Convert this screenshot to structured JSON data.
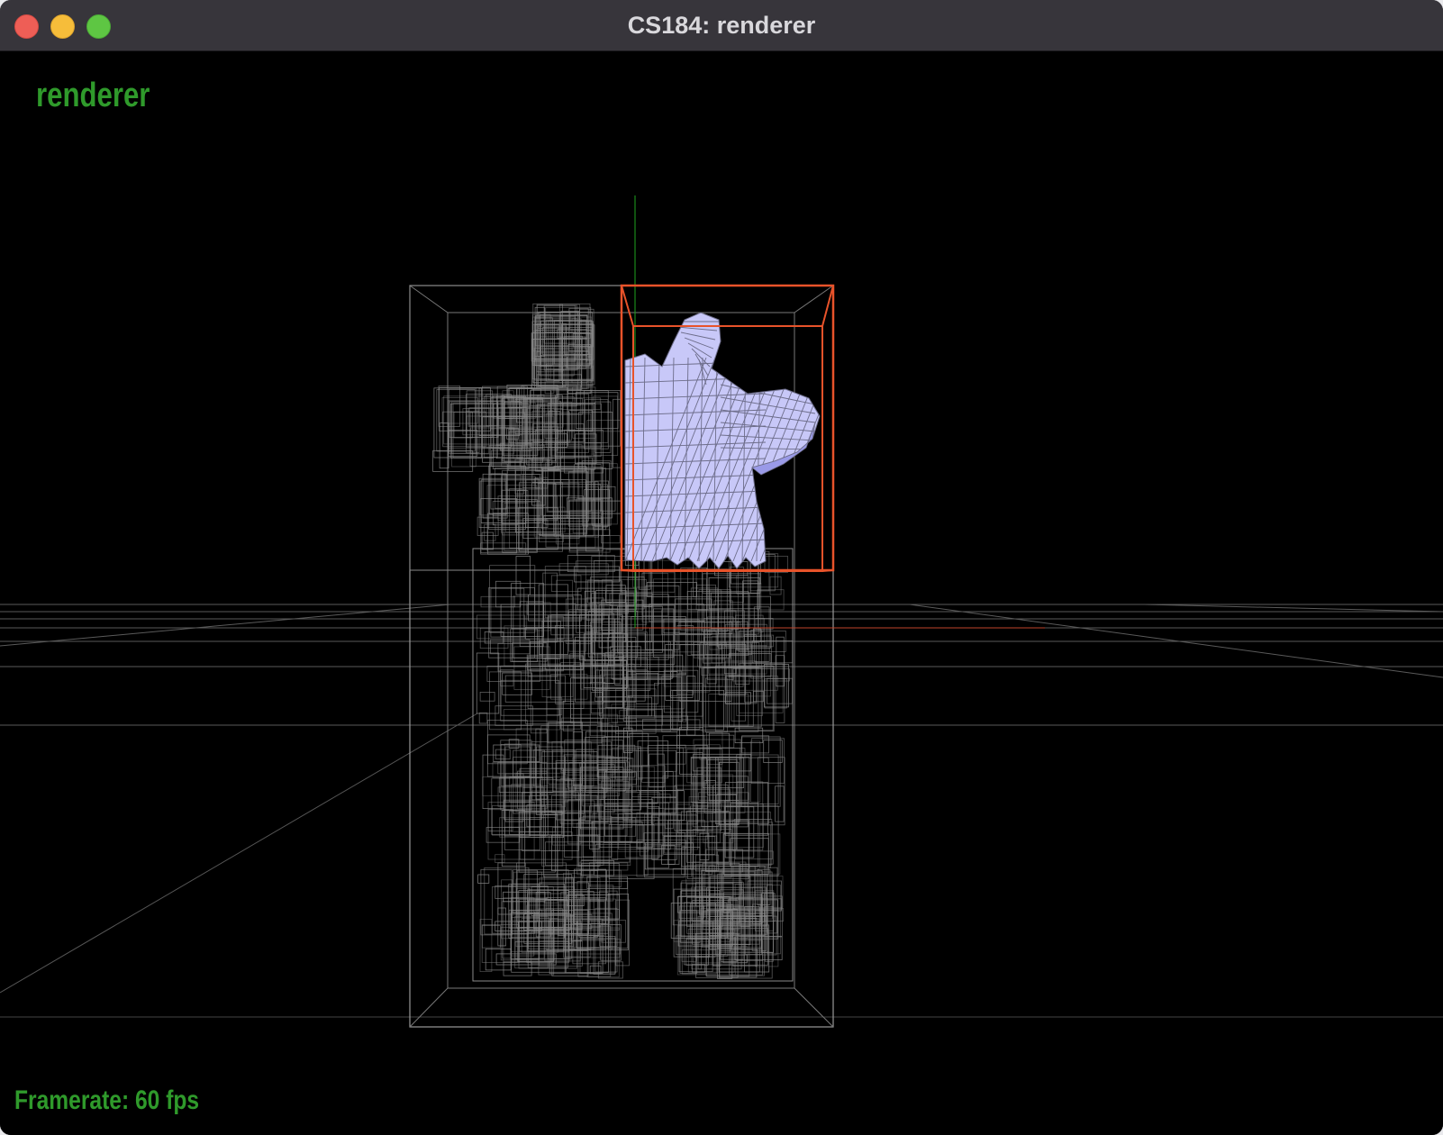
{
  "window": {
    "title": "CS184: renderer",
    "controls": [
      "close",
      "minimize",
      "zoom"
    ]
  },
  "viewport": {
    "app_label": "renderer",
    "framerate_label": "Framerate: 60 fps",
    "colors": {
      "background": "#000000",
      "overlay_text": "#2f9a2b",
      "bvh_boxes": "#8a8a8a",
      "selected_box": "#e8532a",
      "mesh_fill": "#c8c8f8",
      "mesh_edges": "#6d6d8a",
      "axis_y": "#1fa31f",
      "axis_x": "#c0452a"
    }
  }
}
